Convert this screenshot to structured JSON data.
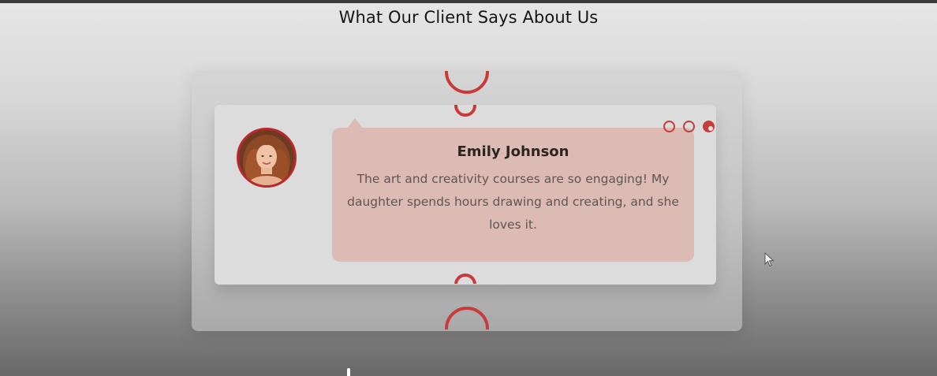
{
  "section": {
    "title": "What Our Client Says About Us"
  },
  "testimonial": {
    "name": "Emily Johnson",
    "text": "The art and creativity courses are so engaging! My daughter spends hours drawing and creating, and she loves it.",
    "avatar_icon": "woman-portrait-avatar"
  },
  "pager": {
    "count": 3,
    "active_index": 2
  },
  "colors": {
    "accent": "#c43c3c",
    "bubble": "#dbbbb4",
    "card": "#dcdcdc"
  },
  "icons": {
    "cursor": "mouse-pointer-icon"
  }
}
